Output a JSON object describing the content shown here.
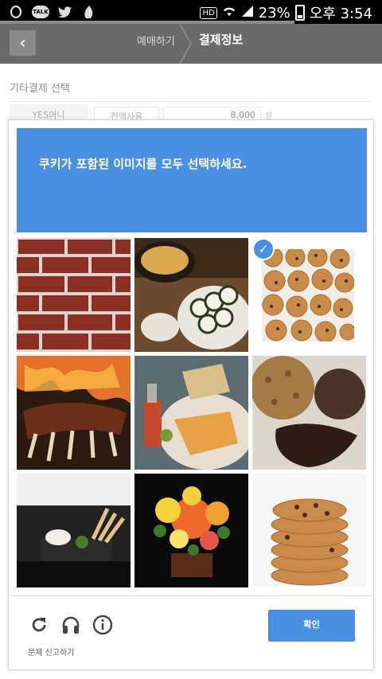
{
  "status_bar": {
    "hd": "HD",
    "battery": "23%",
    "time": "오후 3:54",
    "talk_badge": "TALK"
  },
  "title_bar": {
    "back_glyph": "‹",
    "step_prev": "예매하기",
    "step_current": "결제정보"
  },
  "background_page": {
    "section_title": "기타결제 선택",
    "row_label": "YES머니",
    "use_all_button": "전액사용",
    "amount": "8,000",
    "unit": "원"
  },
  "captcha": {
    "prompt": "쿠키가 포함된 이미지를 모두 선택하세요.",
    "tiles": [
      {
        "subject": "brick-wall",
        "selected": false
      },
      {
        "subject": "miso-soup-sushi",
        "selected": false
      },
      {
        "subject": "cookies-tray",
        "selected": true
      },
      {
        "subject": "grilled-ribs",
        "selected": false
      },
      {
        "subject": "food-platter",
        "selected": false
      },
      {
        "subject": "oatmeal-chocolate-cookies",
        "selected": false
      },
      {
        "subject": "appetizer-plate",
        "selected": false
      },
      {
        "subject": "flower-arrangement",
        "selected": false
      },
      {
        "subject": "cookie-stack",
        "selected": false
      }
    ],
    "icons": [
      "reload-icon",
      "audio-icon",
      "info-icon"
    ],
    "report_label": "문제 신고하기",
    "verify_label": "확인"
  },
  "colors": {
    "accent": "#4a90e2",
    "titlebar": "#6a6a6a"
  }
}
